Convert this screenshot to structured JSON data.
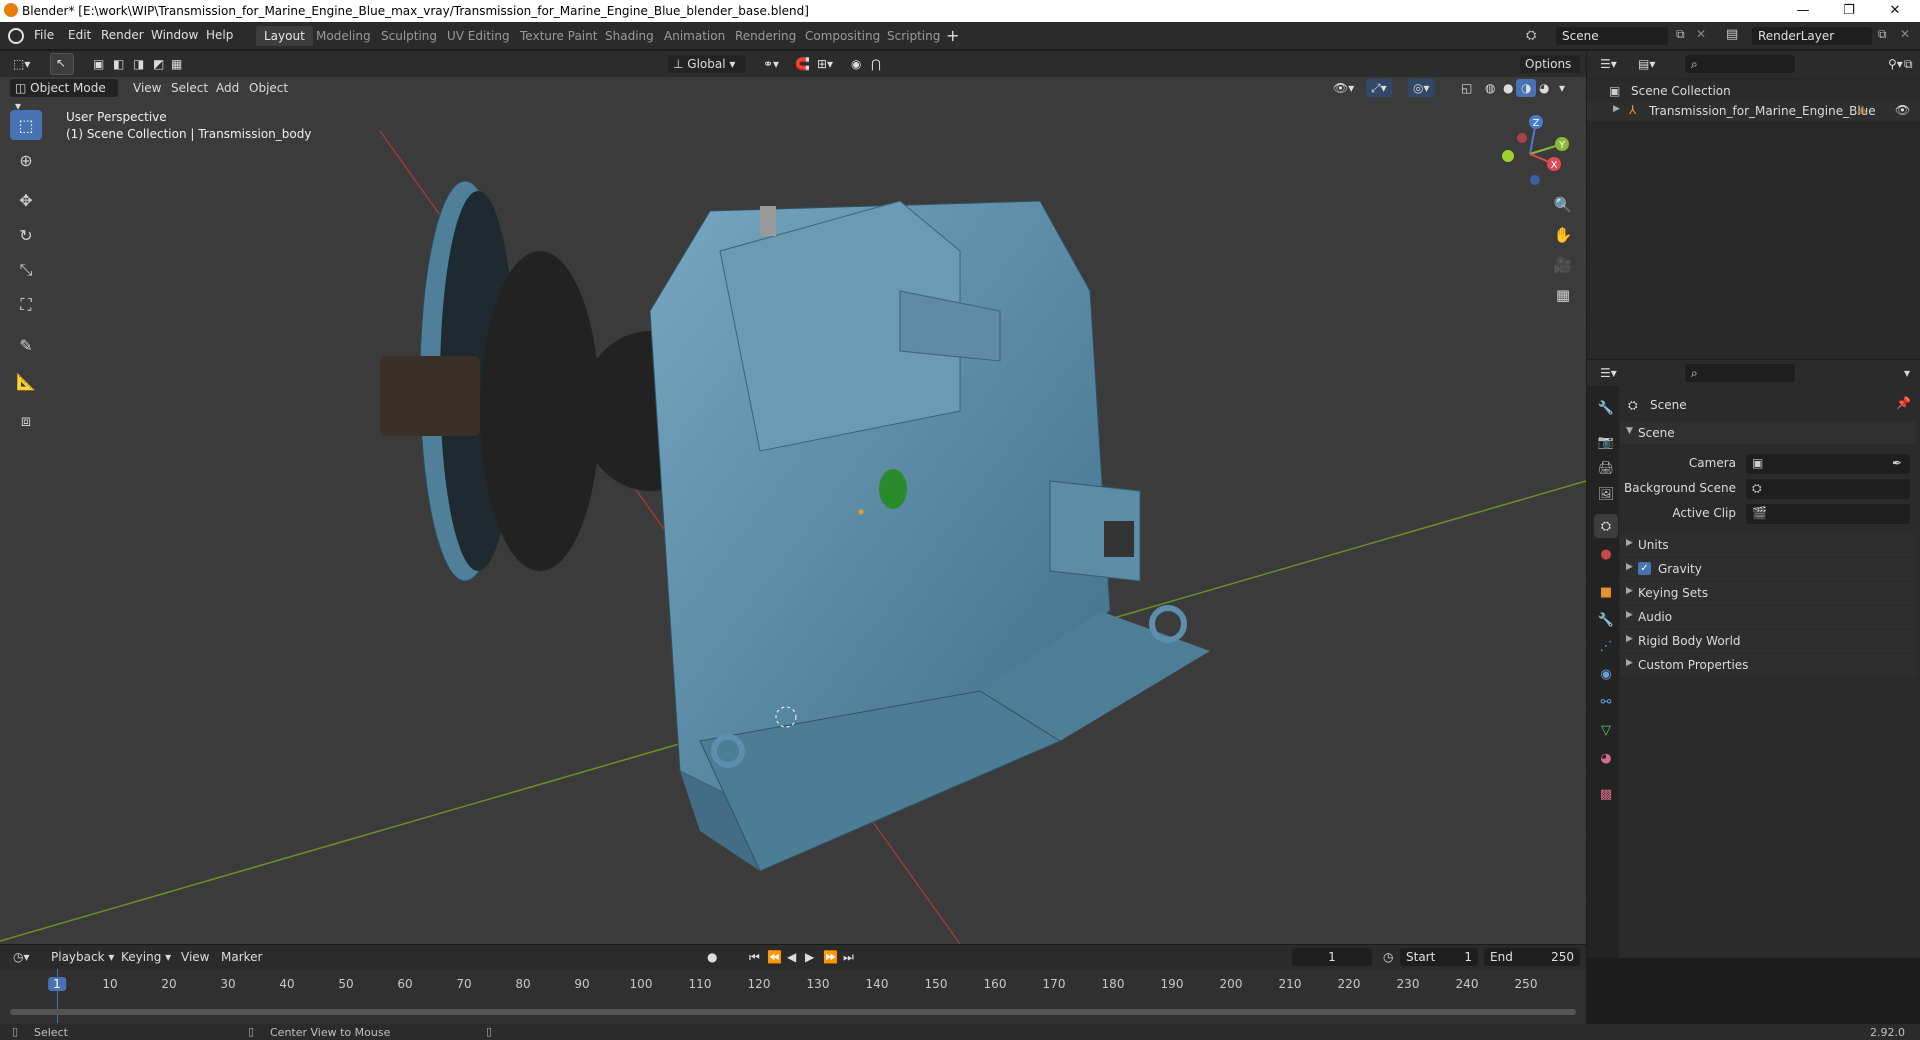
{
  "window": {
    "title": "Blender* [E:\\work\\WIP\\Transmission_for_Marine_Engine_Blue_max_vray/Transmission_for_Marine_Engine_Blue_blender_base.blend]",
    "minimize": "—",
    "maximize": "❐",
    "close": "✕"
  },
  "menus": [
    "File",
    "Edit",
    "Render",
    "Window",
    "Help"
  ],
  "workspaces": [
    "Layout",
    "Modeling",
    "Sculpting",
    "UV Editing",
    "Texture Paint",
    "Shading",
    "Animation",
    "Rendering",
    "Compositing",
    "Scripting"
  ],
  "workspace_add": "+",
  "scene_field": "Scene",
  "renderlayer_field": "RenderLayer",
  "viewport": {
    "mode": "Object Mode",
    "menus": [
      "View",
      "Select",
      "Add",
      "Object"
    ],
    "orientation": "Global",
    "options": "Options",
    "overlay_title": "User Perspective",
    "overlay_subtitle": "(1) Scene Collection | Transmission_body",
    "gizmo_axes": {
      "z": "Z",
      "y": "Y",
      "x": "X"
    }
  },
  "outliner": {
    "root": "Scene Collection",
    "items": [
      "Transmission_for_Marine_Engine_Blue"
    ]
  },
  "properties": {
    "context": "Scene",
    "panel": "Scene",
    "fields": [
      {
        "label": "Camera"
      },
      {
        "label": "Background Scene"
      },
      {
        "label": "Active Clip"
      }
    ],
    "sections": [
      "Units",
      "Gravity",
      "Keying Sets",
      "Audio",
      "Rigid Body World",
      "Custom Properties"
    ],
    "gravity_checked": true
  },
  "timeline": {
    "menus": [
      "Playback",
      "Keying",
      "View",
      "Marker"
    ],
    "current_frame": "1",
    "start_label": "Start",
    "start": "1",
    "end_label": "End",
    "end": "250",
    "ticks": [
      "1",
      "10",
      "20",
      "30",
      "40",
      "50",
      "60",
      "70",
      "80",
      "90",
      "100",
      "110",
      "120",
      "130",
      "140",
      "150",
      "160",
      "170",
      "180",
      "190",
      "200",
      "210",
      "220",
      "230",
      "240",
      "250"
    ]
  },
  "statusbar": {
    "left": "Select",
    "middle": "Center View to Mouse",
    "version": "2.92.0"
  },
  "colors": {
    "accent": "#4772b3",
    "model": "#5c8fab",
    "x_axis": "#9b3a3f",
    "y_axis": "#6d8f2a"
  }
}
